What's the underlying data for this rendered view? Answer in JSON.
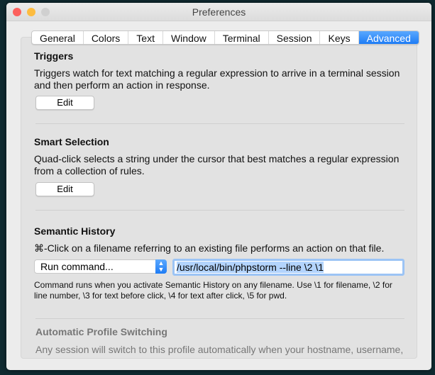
{
  "window": {
    "title": "Preferences"
  },
  "tabs": [
    "General",
    "Colors",
    "Text",
    "Window",
    "Terminal",
    "Session",
    "Keys",
    "Advanced"
  ],
  "active_tab": "Advanced",
  "triggers": {
    "heading": "Triggers",
    "description": "Triggers watch for text matching a regular expression to arrive in a terminal session and then perform an action in response.",
    "button": "Edit"
  },
  "smart_selection": {
    "heading": "Smart Selection",
    "description": "Quad-click selects a string under the cursor that best matches a regular expression from a collection of rules.",
    "button": "Edit"
  },
  "semantic_history": {
    "heading": "Semantic History",
    "description": "⌘-Click on a filename referring to an existing file performs an action on that file.",
    "action_select": "Run command...",
    "command_value": "/usr/local/bin/phpstorm --line \\2 \\1",
    "help": "Command runs when you activate Semantic History on any filename. Use \\1 for filename, \\2 for line number, \\3 for text before click, \\4 for text after click, \\5 for pwd."
  },
  "auto_profile": {
    "heading": "Automatic Profile Switching",
    "description": "Any session will switch to this profile automatically when your hostname, username,"
  },
  "colors": {
    "accent": "#1e7cf5",
    "close": "#fc605c",
    "minimize": "#fdbc40",
    "zoom": "#d0d0d0"
  }
}
